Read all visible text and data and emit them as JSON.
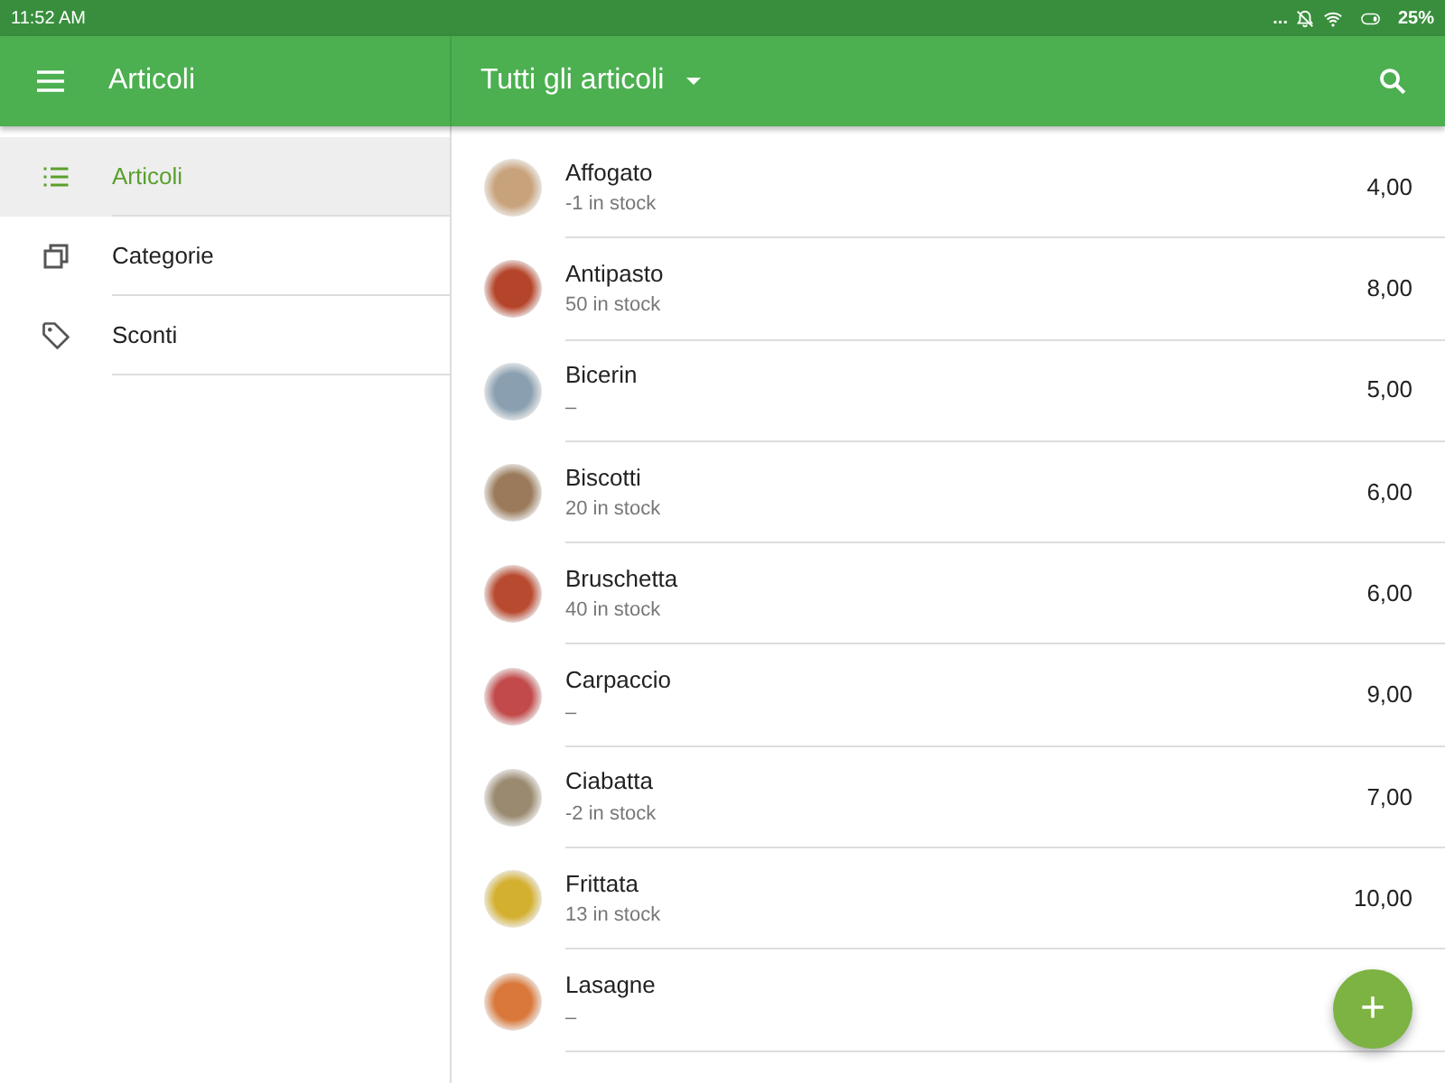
{
  "status_bar": {
    "time": "11:52 AM",
    "more": "...",
    "battery": "25%"
  },
  "sidebar": {
    "title": "Articoli",
    "items": [
      {
        "label": "Articoli",
        "kind": "list",
        "selected": true
      },
      {
        "label": "Categorie",
        "kind": "copy",
        "selected": false
      },
      {
        "label": "Sconti",
        "kind": "tag",
        "selected": false
      }
    ]
  },
  "main": {
    "title": "Tutti gli articoli"
  },
  "items": [
    {
      "name": "Affogato",
      "stock": "-1 in stock",
      "price": "4,00"
    },
    {
      "name": "Antipasto",
      "stock": "50 in stock",
      "price": "8,00"
    },
    {
      "name": "Bicerin",
      "stock": "–",
      "price": "5,00"
    },
    {
      "name": "Biscotti",
      "stock": "20 in stock",
      "price": "6,00"
    },
    {
      "name": "Bruschetta",
      "stock": "40 in stock",
      "price": "6,00"
    },
    {
      "name": "Carpaccio",
      "stock": "–",
      "price": "9,00"
    },
    {
      "name": "Ciabatta",
      "stock": "-2 in stock",
      "price": "7,00"
    },
    {
      "name": "Frittata",
      "stock": "13 in stock",
      "price": "10,00"
    },
    {
      "name": "Lasagne",
      "stock": "–"
    }
  ],
  "fab": {
    "label": "+"
  }
}
